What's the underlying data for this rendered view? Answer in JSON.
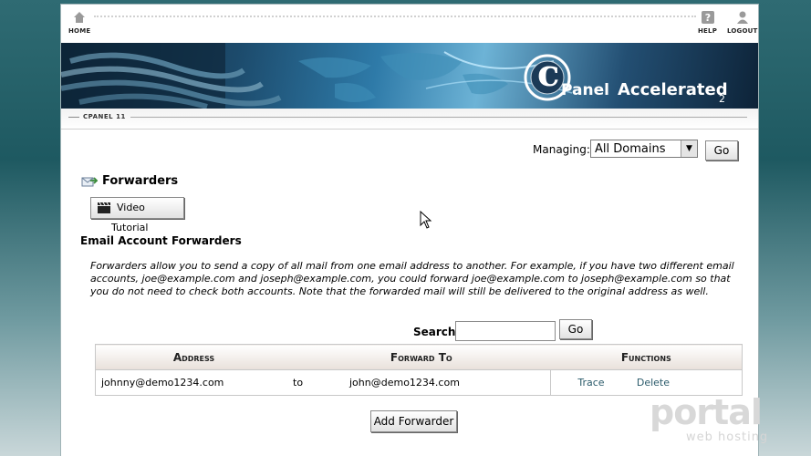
{
  "nav": {
    "home_label": "HOME",
    "help_label": "HELP",
    "logout_label": "LOGOUT"
  },
  "banner": {
    "brand_c": "c",
    "brand_panel": "Panel",
    "brand_accel": "Accelerated",
    "brand_version": "2"
  },
  "breadcrumb": {
    "tab_label": "CPANEL 11"
  },
  "managing": {
    "label": "Managing:",
    "selected": "All Domains",
    "go_label": "Go"
  },
  "page": {
    "title": "Forwarders",
    "video_label": "Video Tutorial",
    "section_title": "Email Account Forwarders",
    "description": "Forwarders allow you to send a copy of all mail from one email address to another. For example, if you have two different email accounts, joe@example.com and joseph@example.com, you could forward joe@example.com to joseph@example.com so that you do not need to check both accounts. Note that the forwarded mail will still be delivered to the original address as well."
  },
  "search": {
    "label": "Search",
    "value": "",
    "go_label": "Go"
  },
  "table": {
    "headers": {
      "address": "Address",
      "forward_to": "Forward To",
      "functions": "Functions"
    },
    "rows": [
      {
        "address": "johnny@demo1234.com",
        "sep": "to",
        "forward_to": "john@demo1234.com",
        "trace": "Trace",
        "delete": "Delete"
      }
    ]
  },
  "add_forwarder_label": "Add Forwarder",
  "watermark": {
    "brand": "portal",
    "tagline": "web hosting"
  },
  "colors": {
    "link": "#2a5a6a",
    "banner": "#1c4a6b",
    "accent_red": "#c8102e"
  }
}
